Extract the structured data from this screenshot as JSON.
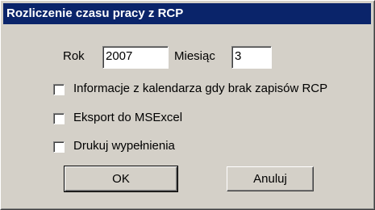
{
  "window": {
    "title": "Rozliczenie czasu pracy z RCP"
  },
  "form": {
    "year_label": "Rok",
    "year_value": "2007",
    "month_label": "Miesiąc",
    "month_value": "3"
  },
  "options": [
    {
      "label": "Informacje z kalendarza gdy brak zapisów RCP",
      "checked": false
    },
    {
      "label": "Eksport do MSExcel",
      "checked": false
    },
    {
      "label": "Drukuj wypełnienia",
      "checked": false
    }
  ],
  "buttons": {
    "ok_label": "OK",
    "cancel_label": "Anuluj"
  },
  "colors": {
    "titlebar": "#0a246a",
    "face": "#d4d0c8"
  }
}
